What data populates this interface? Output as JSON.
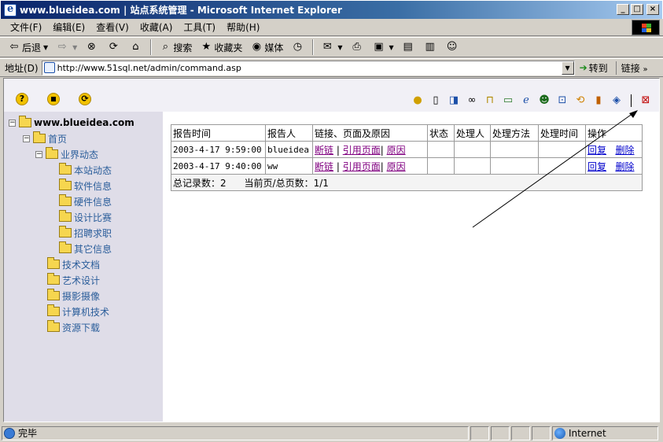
{
  "window": {
    "title": "www.blueidea.com    | 站点系统管理 - Microsoft Internet Explorer",
    "min": "_",
    "max": "□",
    "close": "×"
  },
  "menu": {
    "items": [
      "文件(F)",
      "编辑(E)",
      "查看(V)",
      "收藏(A)",
      "工具(T)",
      "帮助(H)"
    ]
  },
  "toolbar": {
    "back": "后退",
    "search": "搜索",
    "favorites": "收藏夹",
    "media": "媒体"
  },
  "address": {
    "label": "地址(D)",
    "url": "http://www.51sql.net/admin/command.asp",
    "go": "转到",
    "links": "链接"
  },
  "tree": {
    "root": "www.blueidea.com",
    "home": "首页",
    "industry": "业界动态",
    "industry_children": [
      "本站动态",
      "软件信息",
      "硬件信息",
      "设计比赛",
      "招聘求职",
      "其它信息"
    ],
    "others": [
      "技术文档",
      "艺术设计",
      "摄影摄像",
      "计算机技术",
      "资源下载"
    ]
  },
  "report": {
    "headers": [
      "报告时间",
      "报告人",
      "链接、页面及原因",
      "状态",
      "处理人",
      "处理方法",
      "处理时间",
      "操作"
    ],
    "rows": [
      {
        "time": "2003-4-17 9:59:00",
        "reporter": "blueidea",
        "link1": "断链",
        "link2": "引用页面",
        "link3": "原因",
        "op1": "回复",
        "op2": "删除"
      },
      {
        "time": "2003-4-17 9:40:00",
        "reporter": "ww",
        "link1": "断链",
        "link2": "引用页面",
        "link3": "原因",
        "op1": "回复",
        "op2": "删除"
      }
    ],
    "pipe": "|",
    "footer_total": "总记录数：2",
    "footer_pages": "当前页/总页数：1/1"
  },
  "status": {
    "text": "完毕",
    "zone": "Internet"
  }
}
